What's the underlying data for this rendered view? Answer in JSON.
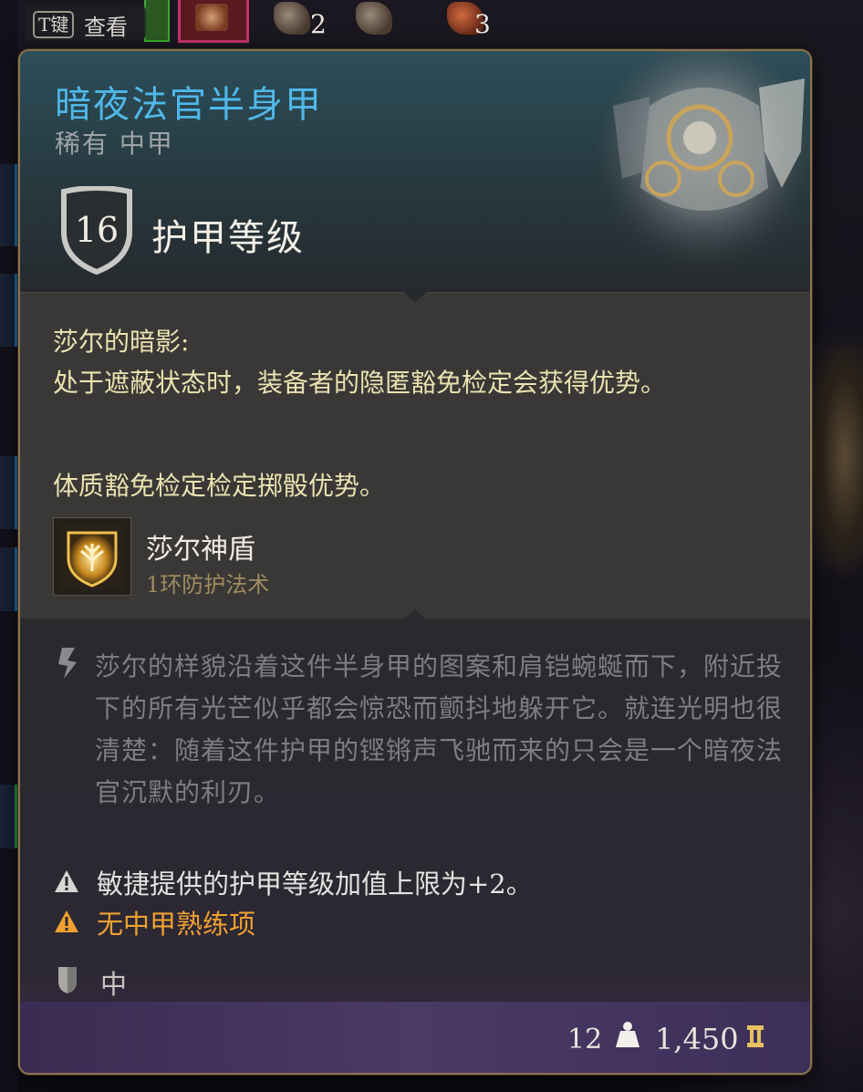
{
  "hotbar": {
    "counts": [
      "2",
      "3"
    ]
  },
  "examine_hint": {
    "key": "T键",
    "label": "查看"
  },
  "item": {
    "name": "暗夜法官半身甲",
    "rarity_type": "稀有 中甲",
    "armor_class_value": "16",
    "armor_class_label": "护甲等级",
    "name_color": "#4fb8e8"
  },
  "properties": {
    "title": "莎尔的暗影:",
    "description": "处于遮蔽状态时，装备者的隐匿豁免检定会获得优势。",
    "constitution": "体质豁免检定检定掷骰优势。",
    "spell": {
      "icon": "shield-of-shar-icon",
      "name": "莎尔神盾",
      "level": "1环防护法术"
    }
  },
  "lore": {
    "icon": "quill-icon",
    "text": "莎尔的样貌沿着这件半身甲的图案和肩铠蜿蜒而下，附近投下的所有光芒似乎都会惊恐而颤抖地躲开它。就连光明也很清楚：随着这件护甲的铿锵声飞驰而来的只会是一个暗夜法官沉默的利刃。"
  },
  "warnings": [
    {
      "icon": "warning-icon",
      "text": "敏捷提供的护甲等级加值上限为+2。",
      "color": "#e4e2de"
    },
    {
      "icon": "warning-orange-icon",
      "text": "无中甲熟练项",
      "color": "#f0a030"
    }
  ],
  "armor_type": {
    "icon": "armor-type-shield-icon",
    "label": "中甲"
  },
  "footer": {
    "weight": "12",
    "weight_icon": "weight-icon",
    "value": "1,450",
    "value_icon": "gold-coin-icon"
  }
}
